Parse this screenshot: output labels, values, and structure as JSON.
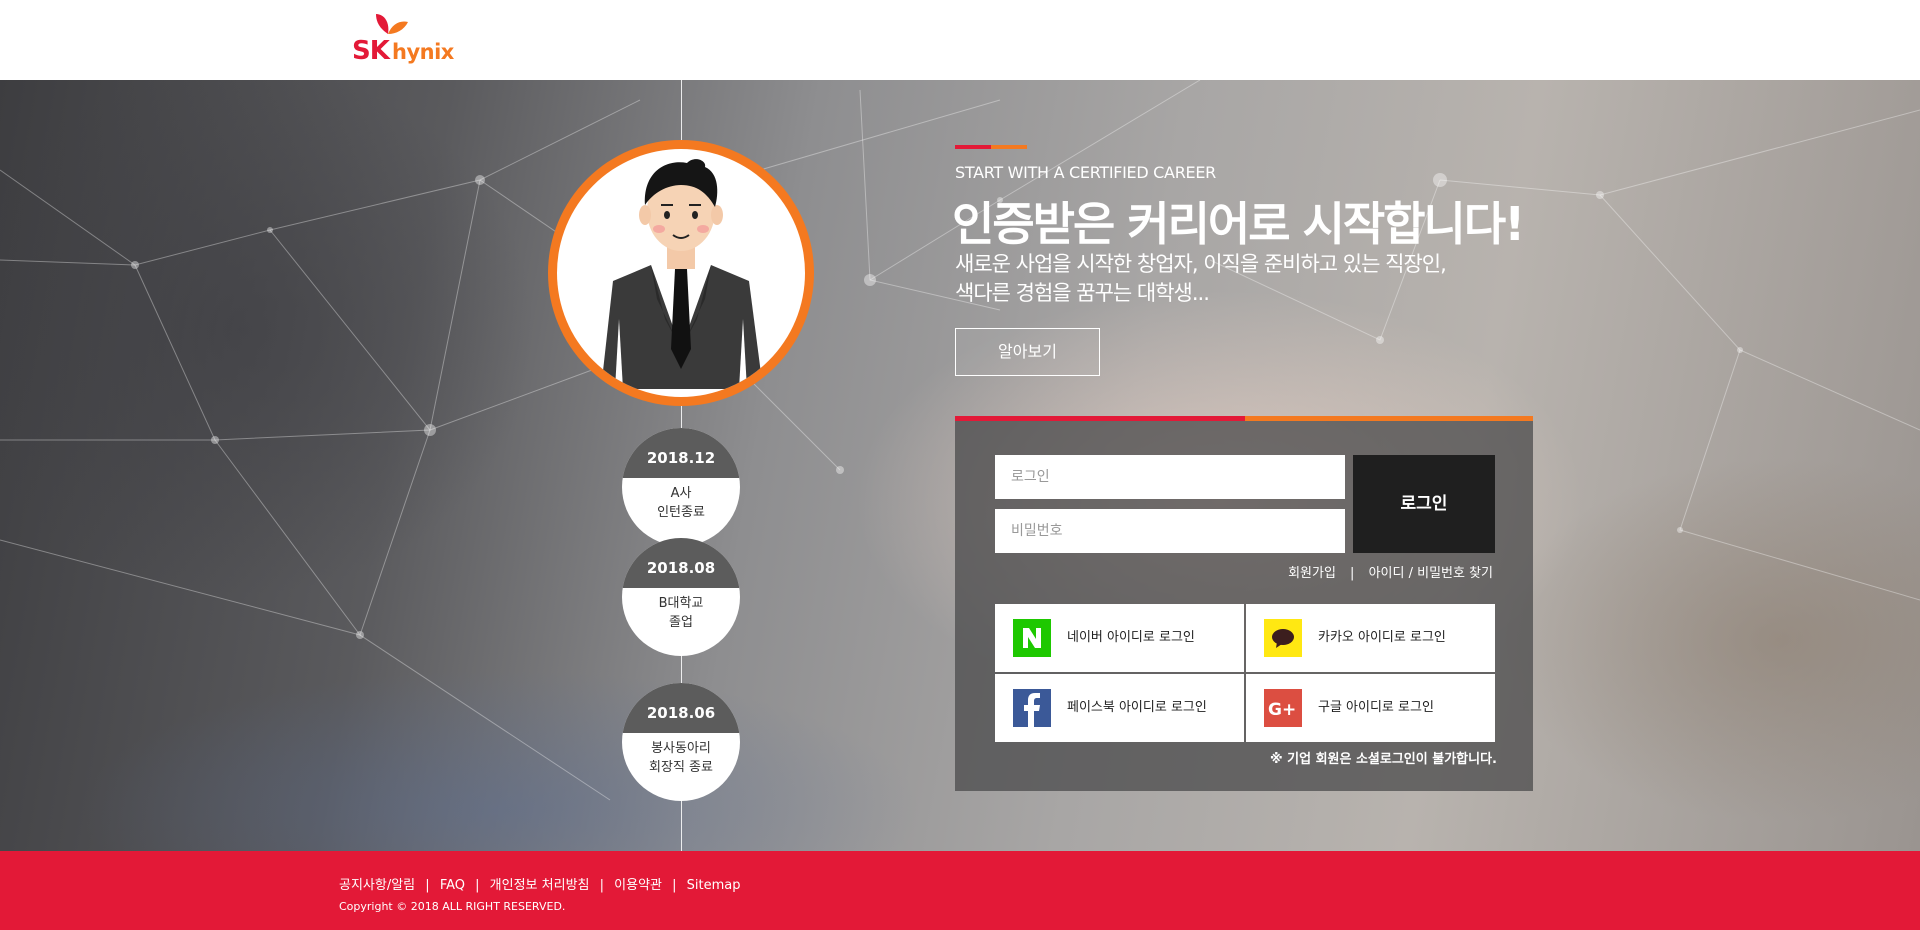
{
  "header": {
    "logo_sk": "SK",
    "logo_hynix": "hynix"
  },
  "colors": {
    "brand_red": "#e31937",
    "brand_orange": "#f47920",
    "dark": "#1f1f1f"
  },
  "timeline": [
    {
      "date": "2018.12",
      "line1": "A사",
      "line2": "인턴종료"
    },
    {
      "date": "2018.08",
      "line1": "B대학교",
      "line2": "졸업"
    },
    {
      "date": "2018.06",
      "line1": "봉사동아리",
      "line2": "회장직 종료"
    }
  ],
  "hero": {
    "tagline_en": "START WITH A CERTIFIED CAREER",
    "headline": "인증받은 커리어로 시작합니다!",
    "sub_line1": "새로운 사업을 시작한 창업자, 이직을 준비하고 있는 직장인,",
    "sub_line2": "색다른 경험을 꿈꾸는 대학생...",
    "learn_more": "알아보기"
  },
  "login": {
    "id_placeholder": "로그인",
    "pw_placeholder": "비밀번호",
    "login_button": "로그인",
    "signup": "회원가입",
    "separator": "|",
    "find_account": "아이디 / 비밀번호 찾기",
    "social": {
      "naver": "네이버 아이디로 로그인",
      "kakao": "카카오 아이디로 로그인",
      "facebook": "페이스북 아이디로 로그인",
      "google": "구글 아이디로 로그인"
    },
    "note": "※ 기업 회원은 소셜로그인이 불가합니다."
  },
  "footer": {
    "links": [
      "공지사항/알림",
      "FAQ",
      "개인정보 처리방침",
      "이용약관",
      "Sitemap"
    ],
    "copyright": "Copyright © 2018  ALL RIGHT RESERVED."
  }
}
